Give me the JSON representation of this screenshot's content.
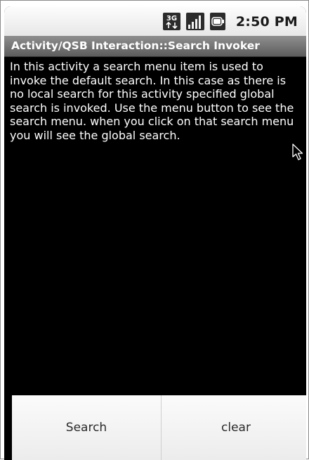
{
  "status_bar": {
    "network_label": "3G",
    "time": "2:50 PM"
  },
  "app": {
    "title": "Activity/QSB Interaction::Search Invoker"
  },
  "content": {
    "description": "In this activity a search menu item is used to invoke the default search. In this case as there is no local search for this activity specified global search is invoked. Use the menu button to see the search menu. when you click on that search menu you will see the global search."
  },
  "buttons": {
    "search_label": "Search",
    "clear_label": "clear"
  },
  "icons": {
    "network": "3g-icon",
    "signal": "signal-strength-icon",
    "battery": "battery-icon",
    "cursor": "mouse-pointer-icon"
  }
}
